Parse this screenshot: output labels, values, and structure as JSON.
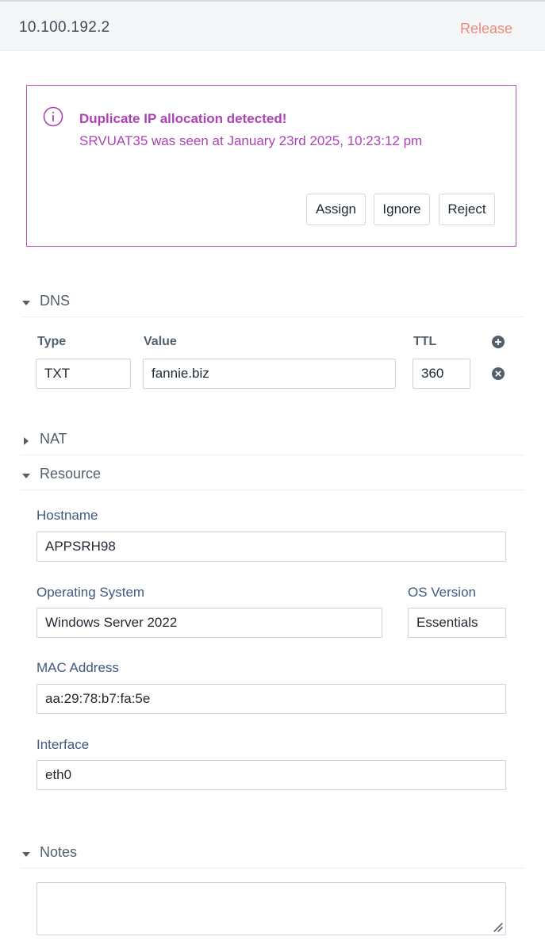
{
  "header": {
    "ip_address": "10.100.192.2",
    "release_label": "Release"
  },
  "alert": {
    "icon": "info-circle-icon",
    "title": "Duplicate IP allocation detected!",
    "message": "SRVUAT35 was seen at January 23rd 2025, 10:23:12 pm",
    "buttons": {
      "assign": "Assign",
      "ignore": "Ignore",
      "reject": "Reject"
    },
    "color": "#ad42b6"
  },
  "dns": {
    "title": "DNS",
    "expanded": true,
    "columns": {
      "type": "Type",
      "value": "Value",
      "ttl": "TTL"
    },
    "records": [
      {
        "type": "TXT",
        "value": "fannie.biz",
        "ttl": "360"
      }
    ]
  },
  "nat": {
    "title": "NAT",
    "expanded": false
  },
  "resource": {
    "title": "Resource",
    "expanded": true,
    "hostname_label": "Hostname",
    "hostname": "APPSRH98",
    "os_label": "Operating System",
    "os": "Windows Server 2022",
    "os_version_label": "OS Version",
    "os_version": "Essentials",
    "mac_label": "MAC Address",
    "mac": "aa:29:78:b7:fa:5e",
    "interface_label": "Interface",
    "interface": "eth0"
  },
  "notes": {
    "title": "Notes",
    "expanded": true,
    "value": ""
  }
}
